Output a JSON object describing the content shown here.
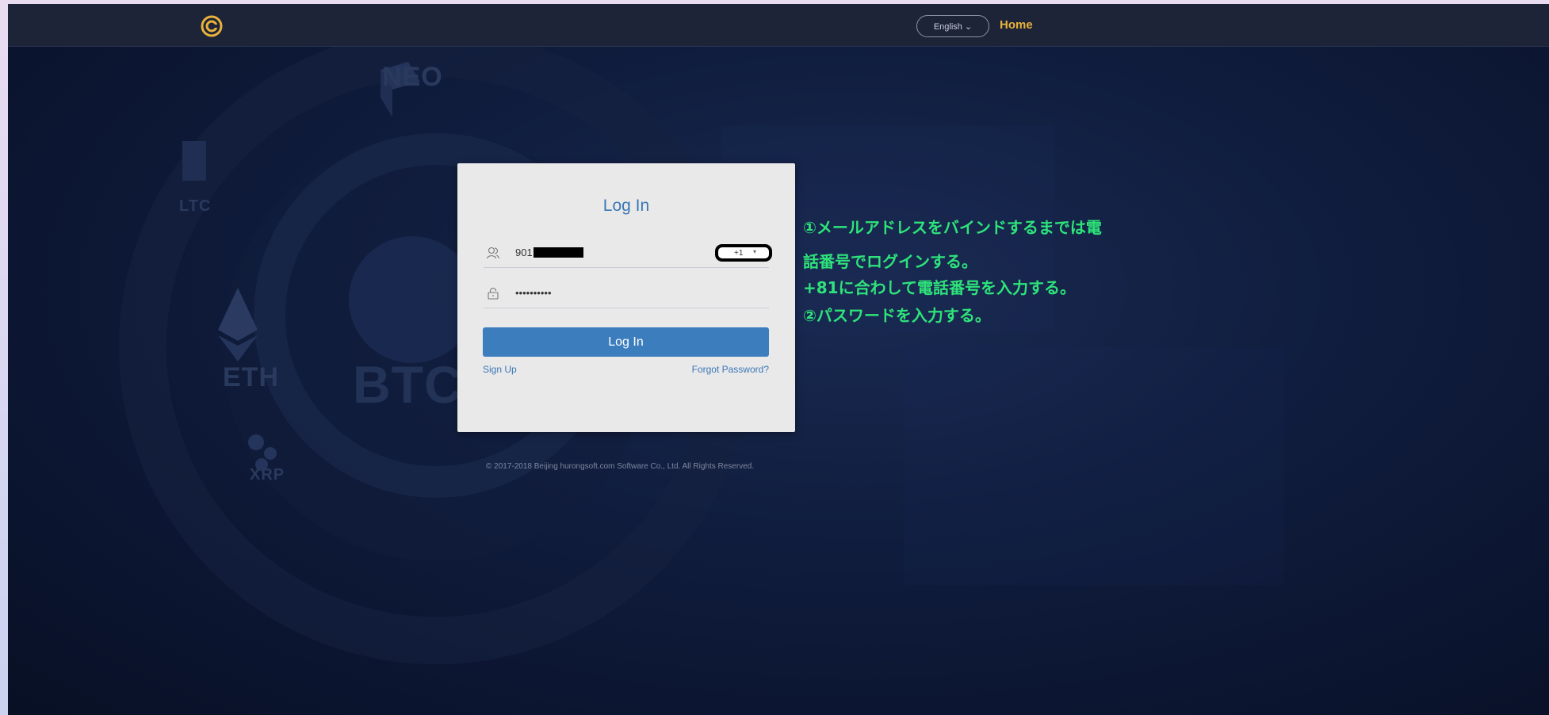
{
  "header": {
    "language_label": "English ⌄",
    "home_label": "Home"
  },
  "background": {
    "coins": [
      "NEO",
      "LTC",
      "ETH",
      "BTC",
      "XRP"
    ]
  },
  "login": {
    "title": "Log In",
    "phone_value_visible": "901",
    "country_code": "+1",
    "country_caret": "▾",
    "password_mask": "••••••••••",
    "submit_label": "Log In",
    "signup_label": "Sign Up",
    "forgot_label": "Forgot Password?"
  },
  "annotations": [
    "①メールアドレスをバインドするまでは電",
    "話番号でログインする。",
    "+81に合わして電話番号を入力する。",
    "②パスワードを入力する。"
  ],
  "footer": {
    "copyright": "© 2017-2018 Beijing hurongsoft.com Software Co., Ltd. All Rights Reserved."
  },
  "colors": {
    "accent": "#3c7dbe",
    "home_link": "#e8b23a",
    "annotation": "#2ee37a"
  }
}
